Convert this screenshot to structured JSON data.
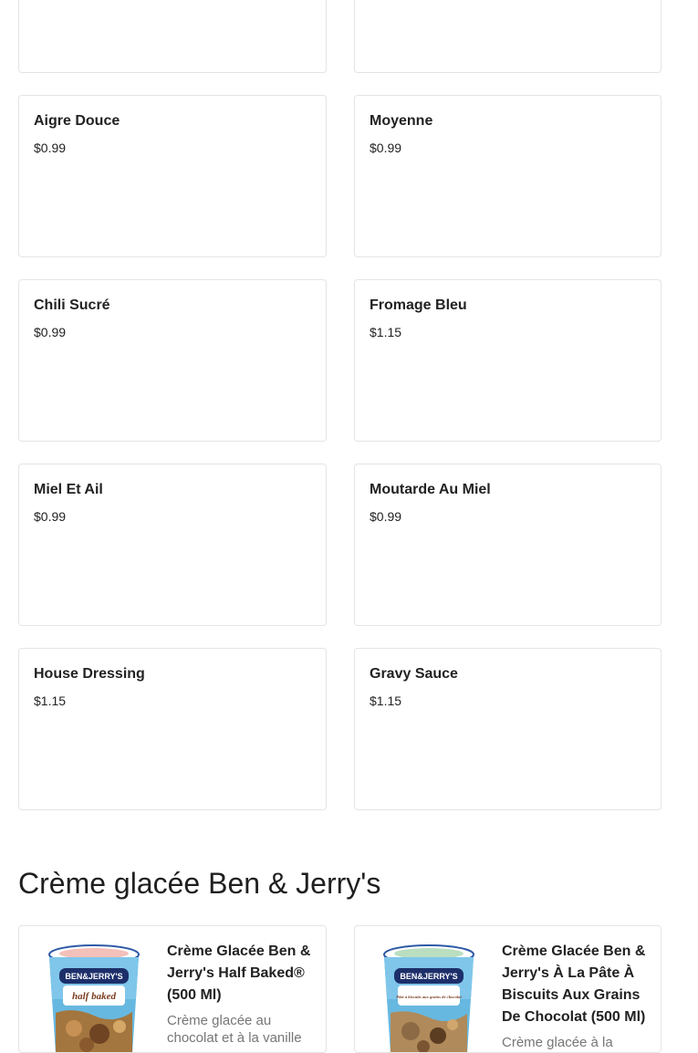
{
  "menu_items": [
    {
      "name": "Aigre Douce",
      "price": "$0.99"
    },
    {
      "name": "Moyenne",
      "price": "$0.99"
    },
    {
      "name": "Chili Sucré",
      "price": "$0.99"
    },
    {
      "name": "Fromage Bleu",
      "price": "$1.15"
    },
    {
      "name": "Miel Et Ail",
      "price": "$0.99"
    },
    {
      "name": "Moutarde Au Miel",
      "price": "$0.99"
    },
    {
      "name": "House Dressing",
      "price": "$1.15"
    },
    {
      "name": "Gravy Sauce",
      "price": "$1.15"
    }
  ],
  "section": {
    "title": "Crème glacée Ben & Jerry's"
  },
  "products": [
    {
      "name": "Crème Glacée Ben & Jerry's Half Baked® (500 Ml)",
      "description": "Crème glacée au chocolat et à la vanille",
      "image_icon": "ice-cream-tub-icon",
      "tub_brand": "BEN&JERRY'S",
      "tub_flavor": "half baked",
      "accent_color": "#3b5fa8"
    },
    {
      "name": "Crème Glacée Ben & Jerry's À La Pâte À Biscuits Aux Grains De Chocolat (500 Ml)",
      "description": "Crème glacée à la vanille",
      "image_icon": "ice-cream-tub-icon",
      "tub_brand": "BEN&JERRY'S",
      "tub_flavor": "Pâte à biscuits aux grains de chocolat",
      "accent_color": "#3b5fa8"
    }
  ]
}
